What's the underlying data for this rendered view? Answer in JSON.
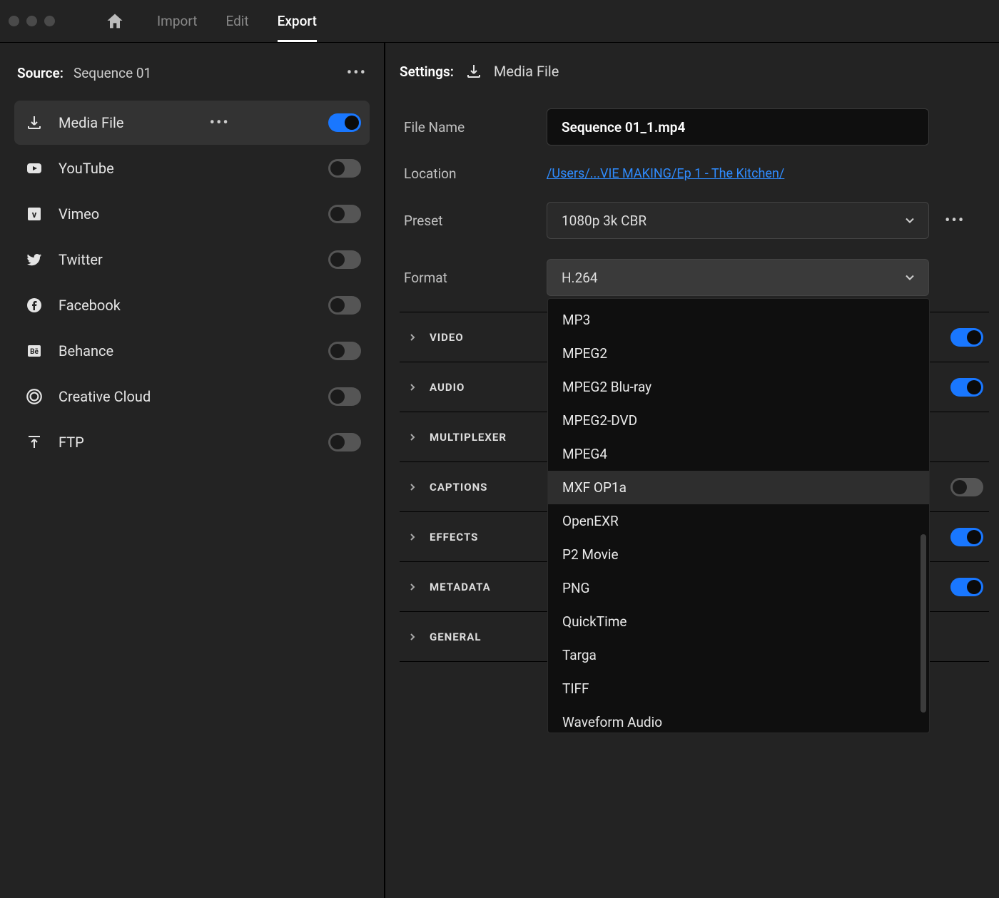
{
  "tabs": {
    "import": "Import",
    "edit": "Edit",
    "export": "Export"
  },
  "source": {
    "label": "Source:",
    "name": "Sequence 01"
  },
  "destinations": [
    {
      "id": "media-file",
      "label": "Media File",
      "icon": "download",
      "enabled": true,
      "selected": true
    },
    {
      "id": "youtube",
      "label": "YouTube",
      "icon": "youtube",
      "enabled": false,
      "selected": false
    },
    {
      "id": "vimeo",
      "label": "Vimeo",
      "icon": "vimeo",
      "enabled": false,
      "selected": false
    },
    {
      "id": "twitter",
      "label": "Twitter",
      "icon": "twitter",
      "enabled": false,
      "selected": false
    },
    {
      "id": "facebook",
      "label": "Facebook",
      "icon": "facebook",
      "enabled": false,
      "selected": false
    },
    {
      "id": "behance",
      "label": "Behance",
      "icon": "behance",
      "enabled": false,
      "selected": false
    },
    {
      "id": "creative-cloud",
      "label": "Creative Cloud",
      "icon": "cc",
      "enabled": false,
      "selected": false
    },
    {
      "id": "ftp",
      "label": "FTP",
      "icon": "upload",
      "enabled": false,
      "selected": false
    }
  ],
  "settings": {
    "label": "Settings:",
    "target": "Media File",
    "filename_label": "File Name",
    "filename": "Sequence 01_1.mp4",
    "location_label": "Location",
    "location": "/Users/...VIE MAKING/Ep 1 - The Kitchen/",
    "preset_label": "Preset",
    "preset": "1080p 3k CBR",
    "format_label": "Format",
    "format": "H.264"
  },
  "format_options": [
    "MP3",
    "MPEG2",
    "MPEG2 Blu-ray",
    "MPEG2-DVD",
    "MPEG4",
    "MXF OP1a",
    "OpenEXR",
    "P2 Movie",
    "PNG",
    "QuickTime",
    "Targa",
    "TIFF",
    "Waveform Audio"
  ],
  "format_highlight_index": 5,
  "sections": [
    {
      "id": "video",
      "label": "VIDEO",
      "enabled": true,
      "has_toggle": true
    },
    {
      "id": "audio",
      "label": "AUDIO",
      "enabled": true,
      "has_toggle": true
    },
    {
      "id": "multiplexer",
      "label": "MULTIPLEXER",
      "enabled": false,
      "has_toggle": false
    },
    {
      "id": "captions",
      "label": "CAPTIONS",
      "enabled": false,
      "has_toggle": true
    },
    {
      "id": "effects",
      "label": "EFFECTS",
      "enabled": true,
      "has_toggle": true
    },
    {
      "id": "metadata",
      "label": "METADATA",
      "enabled": true,
      "has_toggle": true
    },
    {
      "id": "general",
      "label": "GENERAL",
      "enabled": false,
      "has_toggle": false
    }
  ]
}
